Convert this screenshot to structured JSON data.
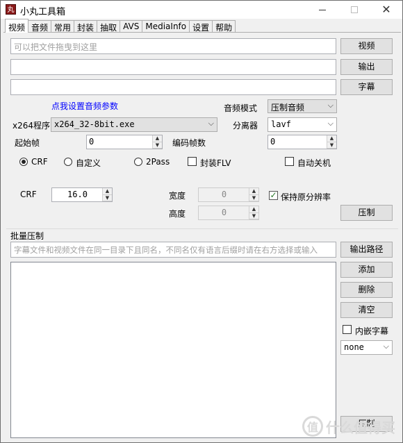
{
  "window": {
    "title": "小丸工具箱",
    "icon_glyph": "丸"
  },
  "tabs": [
    "视频",
    "音频",
    "常用",
    "封装",
    "抽取",
    "AVS",
    "MediaInfo",
    "设置",
    "帮助"
  ],
  "video": {
    "drop_placeholder": "可以把文件拖曳到这里",
    "video_button": "视频",
    "output_button": "输出",
    "subtitle_button": "字幕",
    "audio_settings_link": "点我设置音频参数",
    "audio_mode_label": "音频模式",
    "audio_mode_value": "压制音频",
    "x264_label": "x264程序",
    "x264_value": "x264_32-8bit.exe",
    "splitter_label": "分离器",
    "splitter_value": "lavf",
    "start_frame_label": "起始帧",
    "start_frame_value": "0",
    "encode_frames_label": "编码帧数",
    "encode_frames_value": "0",
    "radio_crf": "CRF",
    "radio_custom": "自定义",
    "radio_2pass": "2Pass",
    "check_flv": "封装FLV",
    "check_shutdown": "自动关机",
    "crf_label": "CRF",
    "crf_value": "16.0",
    "width_label": "宽度",
    "width_value": "0",
    "height_label": "高度",
    "height_value": "0",
    "keep_resolution": "保持原分辨率",
    "encode_button": "压制"
  },
  "batch": {
    "section_label": "批量压制",
    "subtitle_hint": "字幕文件和视频文件在同一目录下且同名，不同名仅有语言后缀时请在右方选择或输入",
    "output_path_button": "输出路径",
    "add_button": "添加",
    "delete_button": "删除",
    "clear_button": "清空",
    "embed_subtitle": "内嵌字幕",
    "subtitle_lang_value": "none",
    "bottom_button": "压制"
  },
  "watermark": {
    "text": "什么值得买",
    "icon": "值"
  }
}
